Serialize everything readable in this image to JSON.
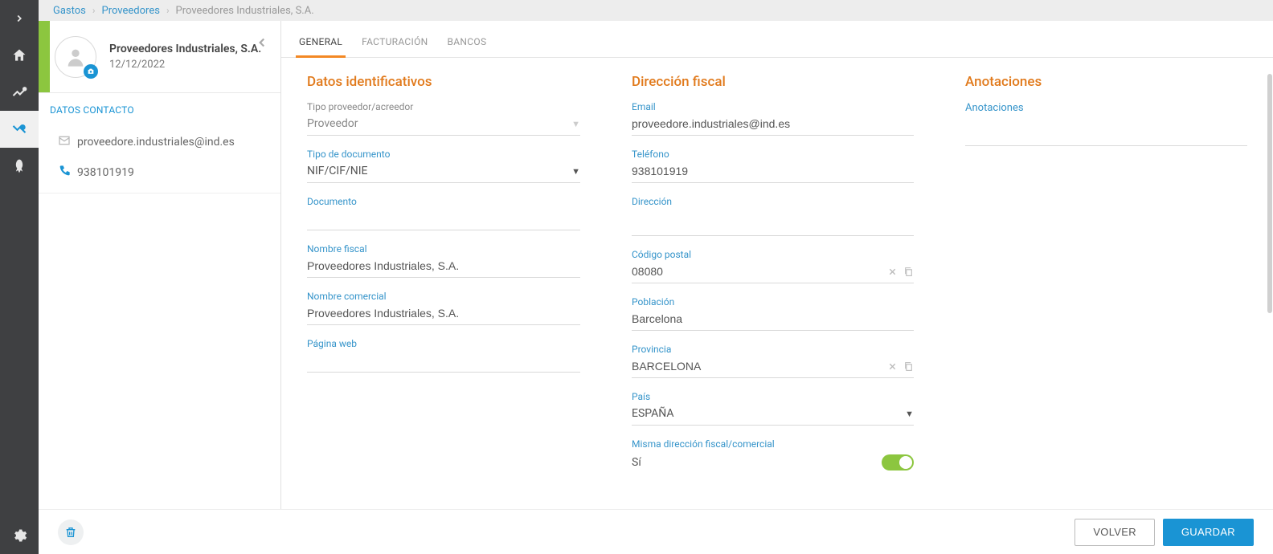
{
  "breadcrumbs": {
    "items": [
      "Gastos",
      "Proveedores",
      "Proveedores Industriales, S.A."
    ]
  },
  "left": {
    "name": "Proveedores Industriales, S.A.",
    "date": "12/12/2022",
    "contact_heading": "DATOS CONTACTO",
    "email": "proveedore.industriales@ind.es",
    "phone": "938101919"
  },
  "tabs": {
    "items": [
      "GENERAL",
      "FACTURACIÓN",
      "BANCOS"
    ],
    "active": 0
  },
  "sections": {
    "identificativos": "Datos identificativos",
    "direccion": "Dirección fiscal",
    "anotaciones_title": "Anotaciones",
    "anotaciones_link": "Anotaciones"
  },
  "labels": {
    "tipo_proveedor": "Tipo proveedor/acreedor",
    "tipo_documento": "Tipo de documento",
    "documento": "Documento",
    "nombre_fiscal": "Nombre fiscal",
    "nombre_comercial": "Nombre comercial",
    "pagina_web": "Página web",
    "email": "Email",
    "telefono": "Teléfono",
    "direccion": "Dirección",
    "codigo_postal": "Código postal",
    "poblacion": "Población",
    "provincia": "Provincia",
    "pais": "País",
    "misma_dir": "Misma dirección fiscal/comercial"
  },
  "values": {
    "tipo_proveedor": "Proveedor",
    "tipo_documento": "NIF/CIF/NIE",
    "documento": "",
    "nombre_fiscal": "Proveedores Industriales, S.A.",
    "nombre_comercial": "Proveedores Industriales, S.A.",
    "pagina_web": "",
    "email": "proveedore.industriales@ind.es",
    "telefono": "938101919",
    "direccion": "",
    "codigo_postal": "08080",
    "poblacion": "Barcelona",
    "provincia": "BARCELONA",
    "pais": "ESPAÑA",
    "misma_dir_text": "Sí"
  },
  "footer": {
    "volver": "VOLVER",
    "guardar": "GUARDAR"
  }
}
